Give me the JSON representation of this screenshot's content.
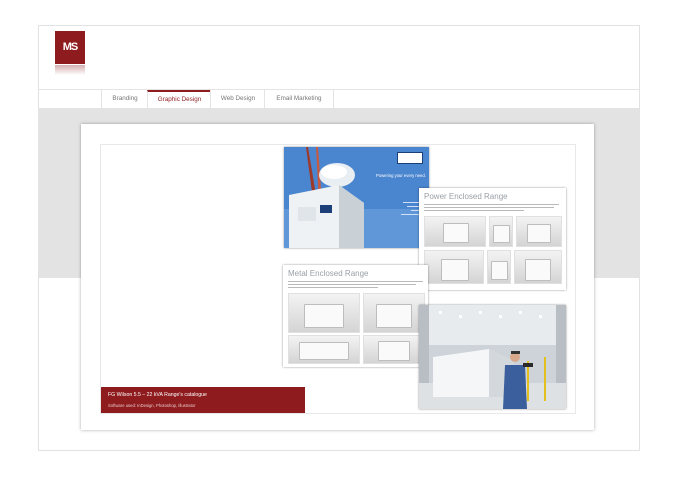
{
  "logo": {
    "text": "MS",
    "alt": "MS logo mark"
  },
  "nav": {
    "tabs": [
      {
        "label": "Branding",
        "active": false
      },
      {
        "label": "Graphic Design",
        "active": true
      },
      {
        "label": "Web Design",
        "active": false
      },
      {
        "label": "Email Marketing",
        "active": false
      }
    ]
  },
  "showcase": {
    "caption_title": "FG Wilson 5.5 – 22 kVA Range's catalogue",
    "caption_sub": "Software used: InDesign, Photoshop, Illustrator",
    "cover_tagline": "Powering your every need.",
    "page1_title": "Power Enclosed Range",
    "page2_title": "Metal Enclosed Range"
  },
  "colors": {
    "brand": "#8e1b1e",
    "band": "#e3e3e3",
    "cover_blue": "#3a78c6"
  }
}
